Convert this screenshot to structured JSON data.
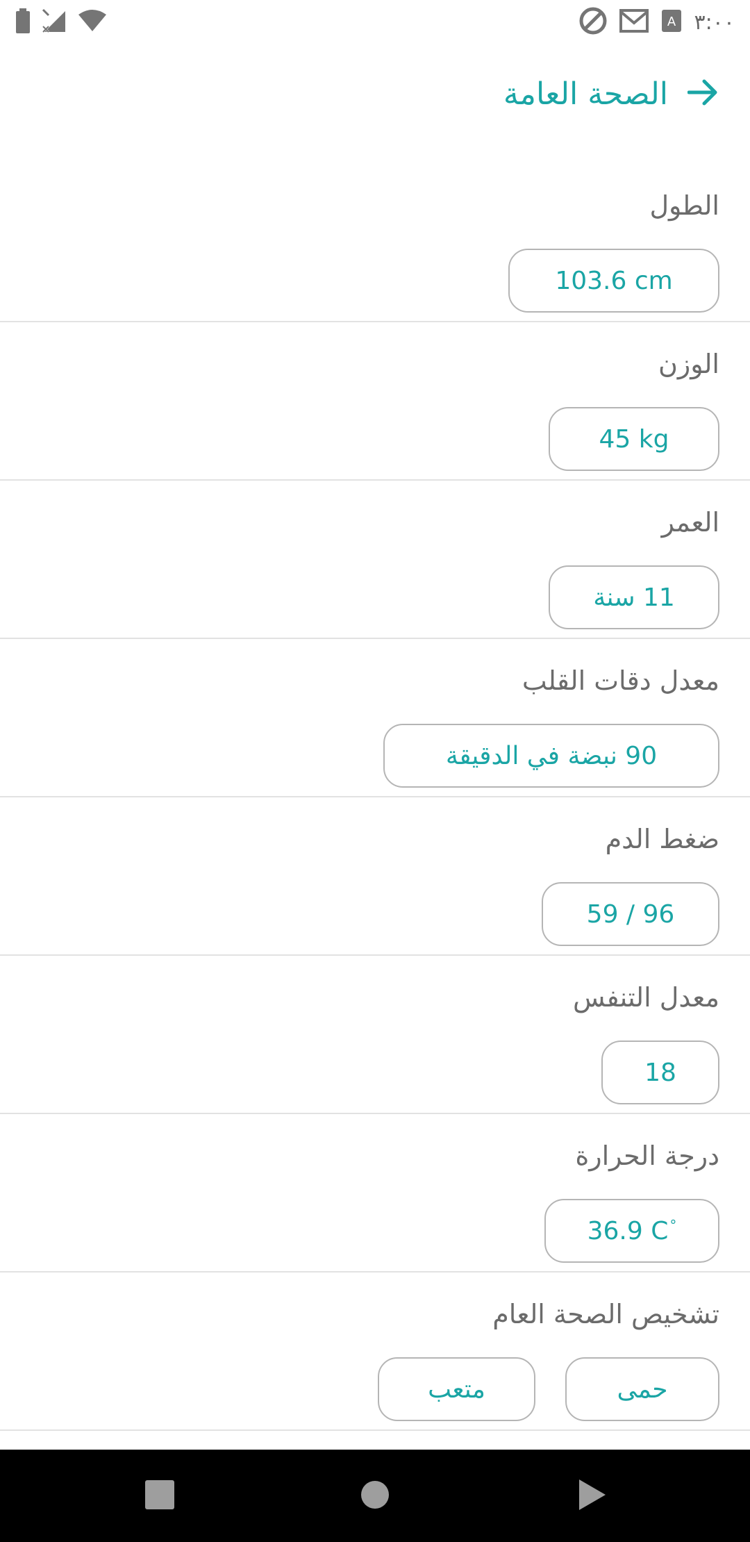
{
  "status_bar": {
    "time": "٣:٠٠",
    "icons_left": [
      "battery-icon",
      "signal-off-icon",
      "wifi-icon"
    ],
    "icons_right": [
      "do-not-disturb-icon",
      "gmail-icon",
      "a-notification-icon"
    ]
  },
  "header": {
    "title": "الصحة العامة",
    "back_icon": "arrow-right-icon"
  },
  "colors": {
    "accent": "#1aa5a5",
    "label": "#6b6b6b",
    "border": "#b5b5b5",
    "divider": "#e2e2e2",
    "nav_bar": "#000000"
  },
  "fields": {
    "height": {
      "label": "الطول",
      "value": "103.6 cm"
    },
    "weight": {
      "label": "الوزن",
      "value": "45 kg"
    },
    "age": {
      "label": "العمر",
      "value": "11 سنة"
    },
    "heart_rate": {
      "label": "معدل دقات القلب",
      "value": "90 نبضة في الدقيقة"
    },
    "blood_pressure": {
      "label": "ضغط الدم",
      "value": "59 / 96"
    },
    "respiration_rate": {
      "label": "معدل التنفس",
      "value": "18"
    },
    "temperature": {
      "label": "درجة الحرارة",
      "value": "36.9 C",
      "unit_mark": "°"
    },
    "diagnosis": {
      "label": "تشخيص الصحة العام",
      "tags": [
        "حمى",
        "متعب"
      ]
    }
  },
  "nav_bar": {
    "buttons": [
      "recent-apps-icon",
      "home-icon",
      "back-icon"
    ]
  }
}
